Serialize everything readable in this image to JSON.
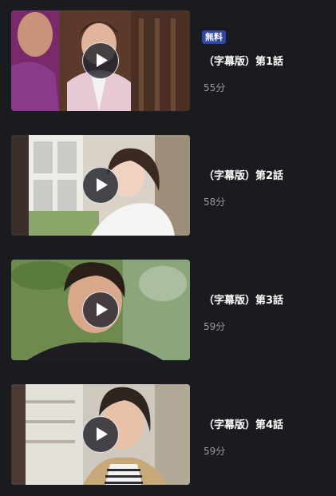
{
  "episodes": [
    {
      "badge": "無料",
      "title": "（字幕版）第1話",
      "duration": "55分"
    },
    {
      "title": "（字幕版）第2話",
      "duration": "58分"
    },
    {
      "title": "（字幕版）第3話",
      "duration": "59分"
    },
    {
      "title": "（字幕版）第4話",
      "duration": "59分"
    }
  ],
  "colors": {
    "background": "#1a1b1f",
    "badge": "#2f48a8",
    "duration_text": "#9a9ba2"
  },
  "icons": {
    "play": "play-icon"
  }
}
